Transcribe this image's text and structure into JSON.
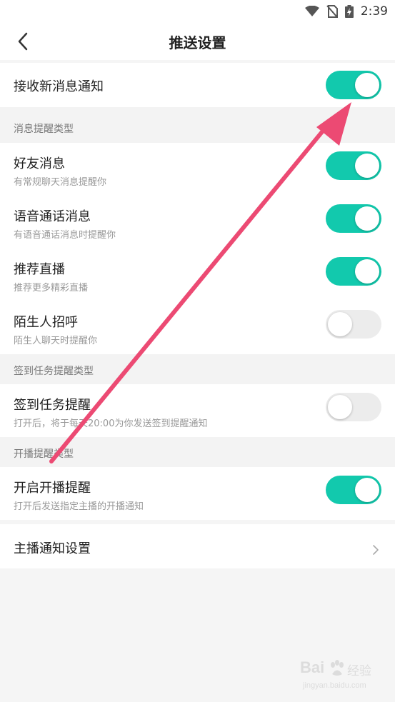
{
  "status_bar": {
    "time": "2:39"
  },
  "header": {
    "title": "推送设置"
  },
  "main_toggle": {
    "title": "接收新消息通知",
    "on": true
  },
  "sections": {
    "message_types": {
      "label": "消息提醒类型"
    },
    "checkin_types": {
      "label": "签到任务提醒类型"
    },
    "live_types": {
      "label": "开播提醒类型"
    }
  },
  "items": [
    {
      "title": "好友消息",
      "subtitle": "有常规聊天消息提醒你",
      "on": true
    },
    {
      "title": "语音通话消息",
      "subtitle": "有语音通话消息时提醒你",
      "on": true
    },
    {
      "title": "推荐直播",
      "subtitle": "推荐更多精彩直播",
      "on": true
    },
    {
      "title": "陌生人招呼",
      "subtitle": "陌生人聊天时提醒你",
      "on": false
    },
    {
      "title": "签到任务提醒",
      "subtitle": "打开后，将于每天20:00为你发送签到提醒通知",
      "on": false
    },
    {
      "title": "开启开播提醒",
      "subtitle": "打开后发送指定主播的开播通知",
      "on": true
    }
  ],
  "anchor_settings": {
    "title": "主播通知设置"
  },
  "watermark": {
    "brand": "Bai",
    "jingyan": "经验",
    "url": "jingyan.baidu.com"
  },
  "colors": {
    "toggle_on": "#12c9ad",
    "toggle_off": "#ececec",
    "arrow": "#ec4a73"
  }
}
